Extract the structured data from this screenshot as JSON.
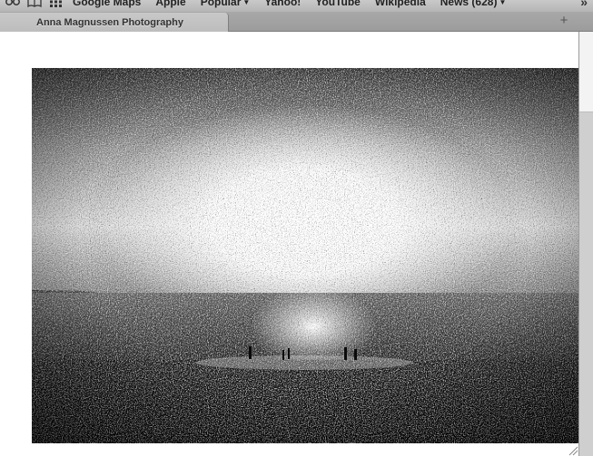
{
  "bookmarks": {
    "items": [
      {
        "label": "Google Maps",
        "menu": false
      },
      {
        "label": "Apple",
        "menu": false
      },
      {
        "label": "Popular",
        "menu": true
      },
      {
        "label": "Yahoo!",
        "menu": false
      },
      {
        "label": "YouTube",
        "menu": false
      },
      {
        "label": "Wikipedia",
        "menu": false
      },
      {
        "label": "News (628)",
        "menu": true
      }
    ],
    "overflow": "»"
  },
  "tab": {
    "title": "Anna Magnussen Photography"
  },
  "new_tab": "+",
  "photo": {
    "icon": "photograph-image"
  }
}
